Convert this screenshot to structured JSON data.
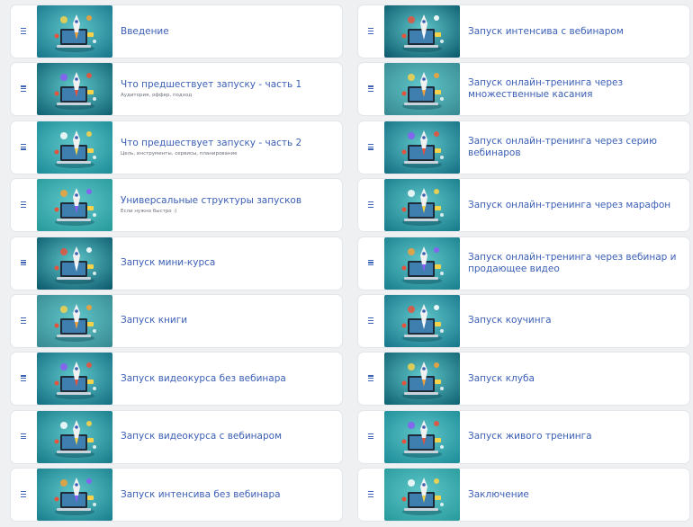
{
  "lessons_left": [
    {
      "title": "Введение",
      "subtitle": "",
      "thumb": "robot-laptop-icon"
    },
    {
      "title": "Что предшествует запуску - часть 1",
      "subtitle": "Аудитория, оффер, подход",
      "thumb": "laptop-rocket-icon"
    },
    {
      "title": "Что предшествует запуску - часть 2",
      "subtitle": "Цель, инструменты, сервисы, планирование",
      "thumb": "laptop-rocket-icon"
    },
    {
      "title": "Универсальные структуры запусков",
      "subtitle": "Если нужно быстро :)",
      "thumb": "open-book-rocket-icon"
    },
    {
      "title": "Запуск мини-курса",
      "subtitle": "",
      "thumb": "laptop-rocket-icon"
    },
    {
      "title": "Запуск книги",
      "subtitle": "",
      "thumb": "book-rocket-icon"
    },
    {
      "title": "Запуск видеокурса без вебинара",
      "subtitle": "",
      "thumb": "desk-rocket-icon"
    },
    {
      "title": "Запуск видеокурса с вебинаром",
      "subtitle": "",
      "thumb": "desk-rocket-icon"
    },
    {
      "title": "Запуск интенсива без вебинара",
      "subtitle": "",
      "thumb": "cloud-rocket-icon"
    }
  ],
  "lessons_right": [
    {
      "title": "Запуск интенсива с вебинаром",
      "subtitle": "",
      "thumb": "rocket-icon"
    },
    {
      "title": "Запуск онлайн-тренинга через множественные касания",
      "subtitle": "",
      "thumb": "laptop-rocket-icon"
    },
    {
      "title": "Запуск онлайн-тренинга через серию вебинаров",
      "subtitle": "",
      "thumb": "screen-rocket-icon"
    },
    {
      "title": "Запуск онлайн-тренинга через марафон",
      "subtitle": "",
      "thumb": "laptop-rocket-icon"
    },
    {
      "title": "Запуск онлайн-тренинга через вебинар и продающее видео",
      "subtitle": "",
      "thumb": "laptop-rocket-icon"
    },
    {
      "title": "Запуск коучинга",
      "subtitle": "",
      "thumb": "laptop-rocket-icon"
    },
    {
      "title": "Запуск клуба",
      "subtitle": "",
      "thumb": "rocket-icon"
    },
    {
      "title": "Запуск живого тренинга",
      "subtitle": "",
      "thumb": "tablet-rocket-icon"
    },
    {
      "title": "Заключение",
      "subtitle": "",
      "thumb": "globe-laptop-icon"
    }
  ],
  "colors": {
    "title": "#3b5fb5",
    "menu_icon": "#3d63b8",
    "thumb_bg": [
      "#1b7a8e",
      "#136575",
      "#1f8f9a",
      "#2a9c9e",
      "#0f5e70",
      "#3a8c94",
      "#177285",
      "#1a7e8c",
      "#1c8290"
    ]
  }
}
